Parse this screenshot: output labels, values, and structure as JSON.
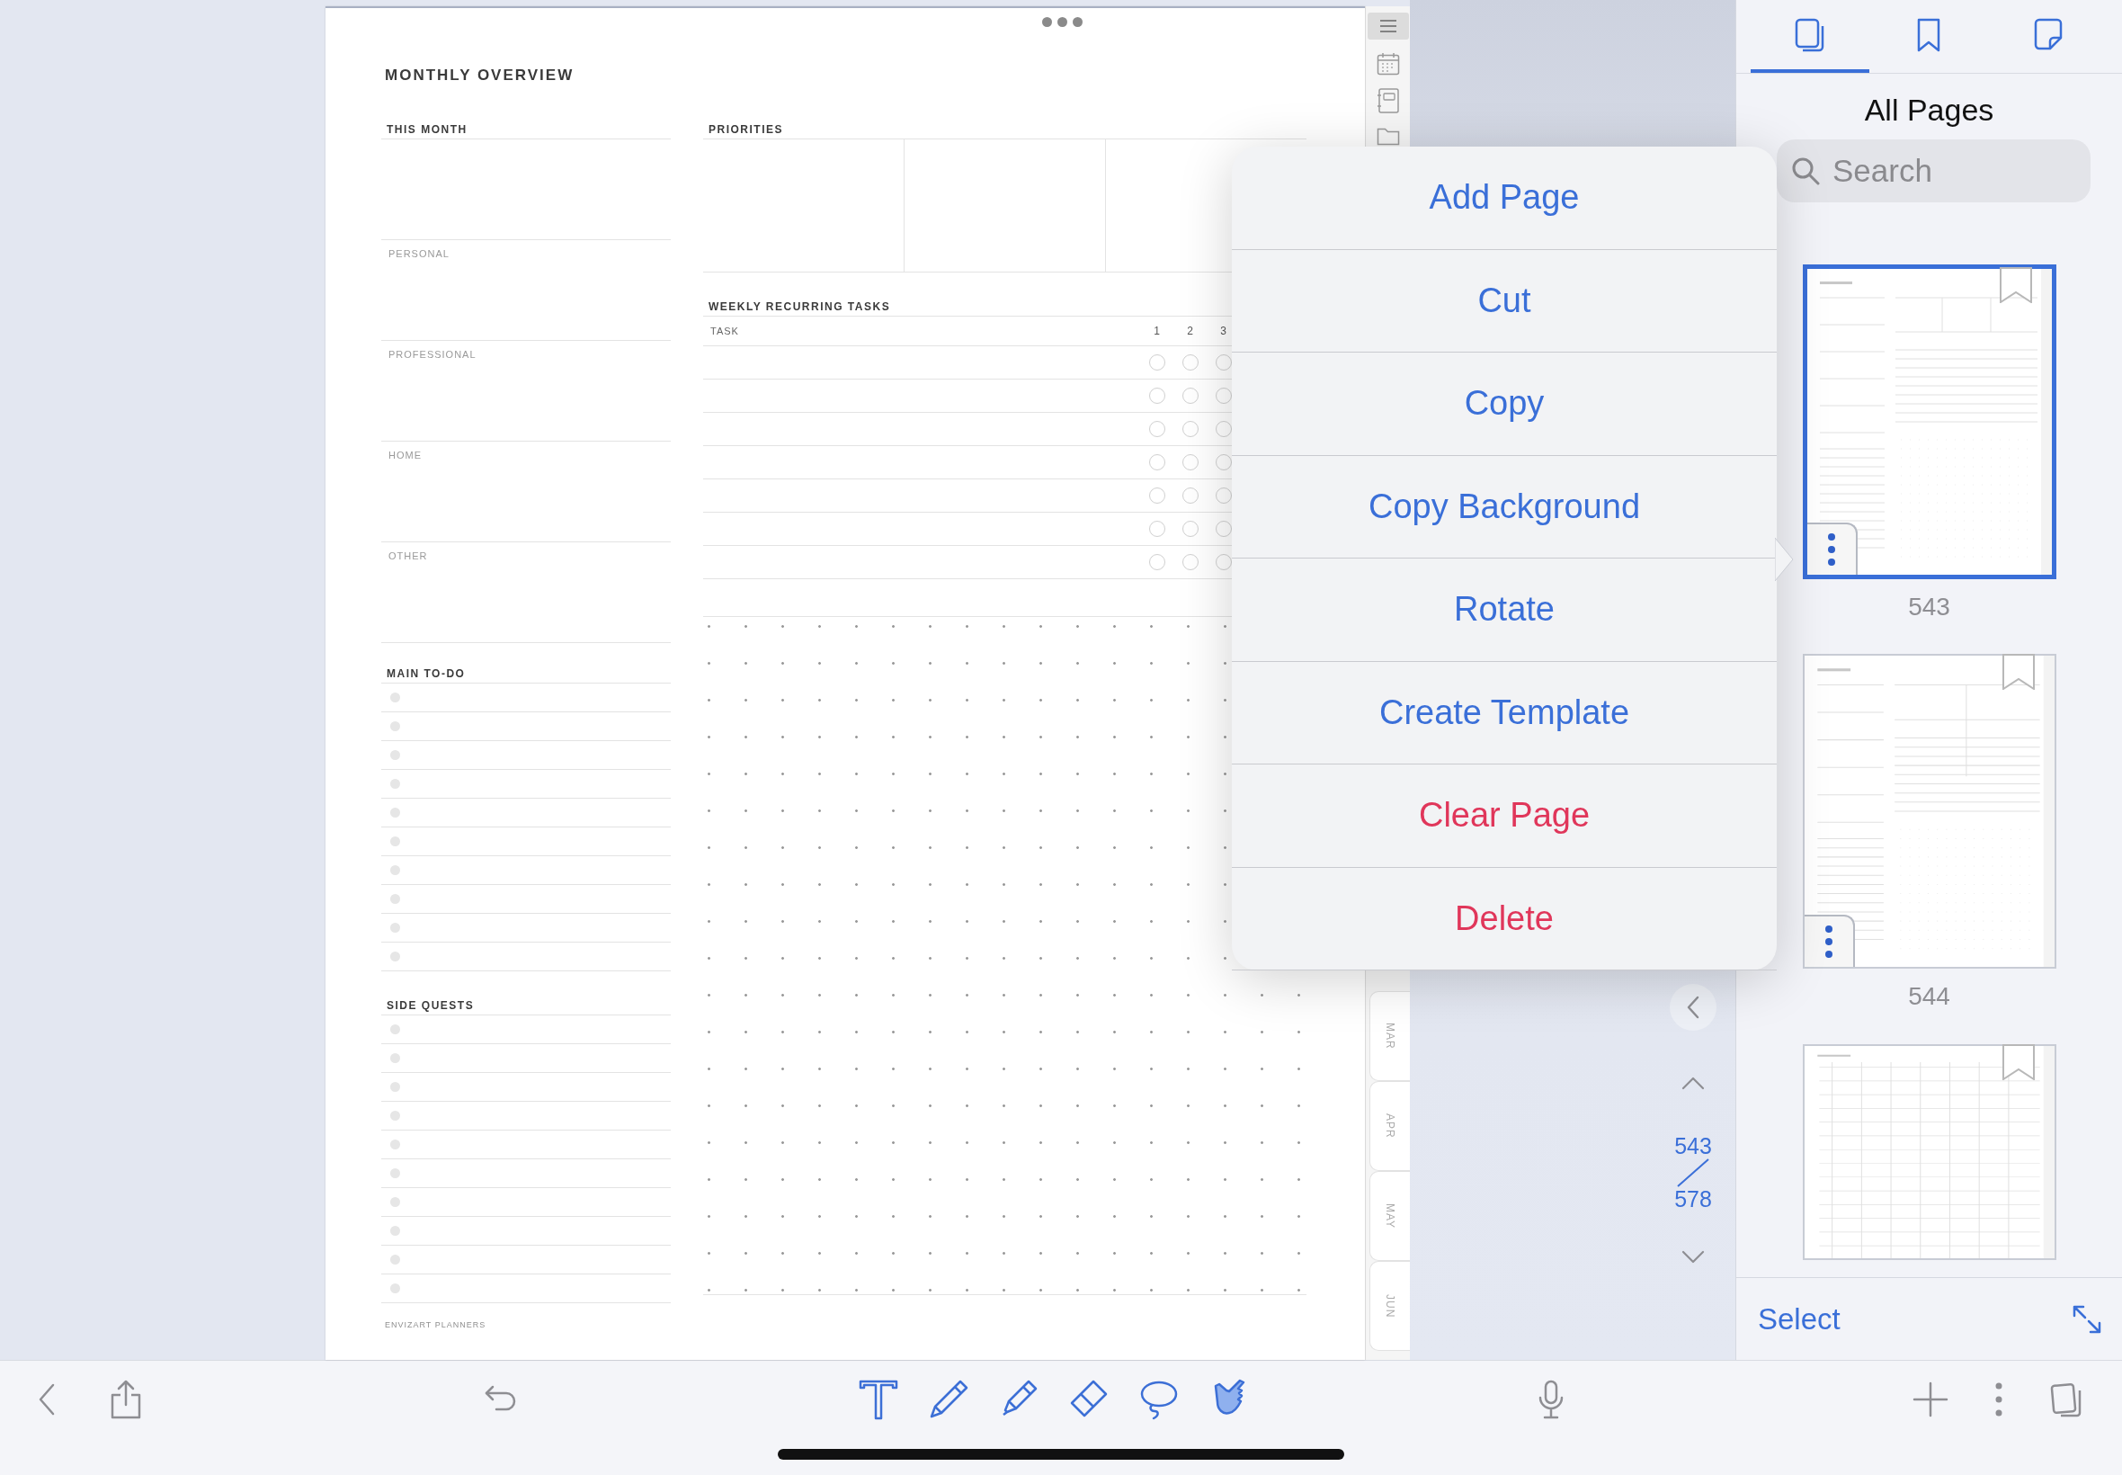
{
  "planner": {
    "title": "MONTHLY OVERVIEW",
    "this_month": {
      "heading": "THIS MONTH",
      "sections": [
        "PERSONAL",
        "PROFESSIONAL",
        "HOME",
        "OTHER"
      ]
    },
    "priorities": {
      "heading": "PRIORITIES"
    },
    "weekly_tasks": {
      "heading": "WEEKLY RECURRING TASKS",
      "task_column": "TASK",
      "day_columns": [
        "1",
        "2",
        "3"
      ]
    },
    "main_todo": {
      "heading": "MAIN TO-DO"
    },
    "side_quests": {
      "heading": "SIDE QUESTS"
    },
    "footer": "ENVIZART PLANNERS",
    "month_tabs": [
      "MAR",
      "APR",
      "MAY",
      "JUN"
    ]
  },
  "context_menu": {
    "items": [
      {
        "label": "Add Page",
        "destructive": false
      },
      {
        "label": "Cut",
        "destructive": false
      },
      {
        "label": "Copy",
        "destructive": false
      },
      {
        "label": "Copy Background",
        "destructive": false
      },
      {
        "label": "Rotate",
        "destructive": false
      },
      {
        "label": "Create Template",
        "destructive": false
      },
      {
        "label": "Clear Page",
        "destructive": true
      },
      {
        "label": "Delete",
        "destructive": true
      }
    ]
  },
  "page_nav": {
    "current": "543",
    "total": "578"
  },
  "sidebar": {
    "tabs": [
      {
        "kind": "pages",
        "selected": true
      },
      {
        "kind": "bookmarks",
        "selected": false
      },
      {
        "kind": "notes",
        "selected": false
      }
    ],
    "title": "All Pages",
    "search": {
      "placeholder": "Search"
    },
    "thumbnails": [
      {
        "label": "543",
        "selected": true
      },
      {
        "label": "544",
        "selected": false
      },
      {
        "selected": false
      }
    ],
    "select_button": "Select"
  },
  "toolbar": {
    "tools": [
      {
        "kind": "text",
        "selected": false
      },
      {
        "kind": "pen",
        "selected": false
      },
      {
        "kind": "highlighter",
        "selected": false
      },
      {
        "kind": "eraser",
        "selected": false
      },
      {
        "kind": "lasso",
        "selected": false
      },
      {
        "kind": "hand",
        "selected": true
      }
    ]
  }
}
